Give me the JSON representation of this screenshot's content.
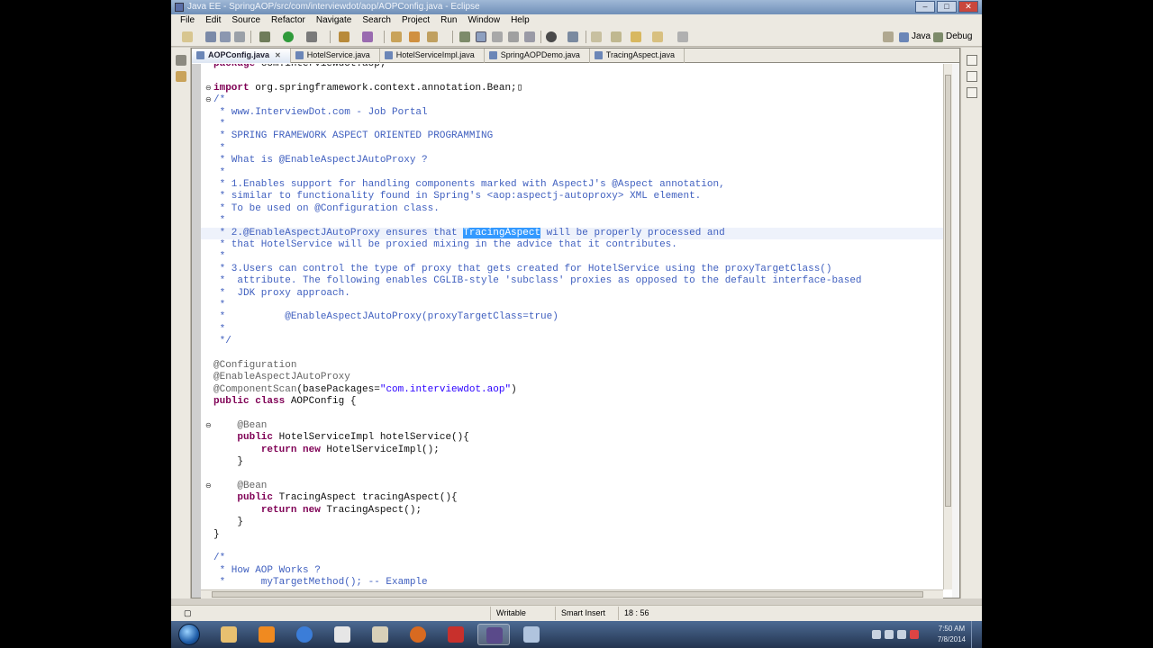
{
  "window": {
    "title": "Java EE - SpringAOP/src/com/interviewdot/aop/AOPConfig.java - Eclipse",
    "controls": [
      "–",
      "□",
      "✕"
    ]
  },
  "menu": [
    "File",
    "Edit",
    "Source",
    "Refactor",
    "Navigate",
    "Search",
    "Project",
    "Run",
    "Window",
    "Help"
  ],
  "perspectives": {
    "java": "Java",
    "debug": "Debug"
  },
  "tabs": [
    {
      "label": "AOPConfig.java",
      "active": true
    },
    {
      "label": "HotelService.java",
      "active": false
    },
    {
      "label": "HotelServiceImpl.java",
      "active": false
    },
    {
      "label": "SpringAOPDemo.java",
      "active": false
    },
    {
      "label": "TracingAspect.java",
      "active": false
    }
  ],
  "code": [
    [
      [
        "package",
        "kw"
      ],
      [
        " com.interviewdot.aop;",
        ""
      ]
    ],
    [],
    [
      [
        "import",
        "kw"
      ],
      [
        " org.springframework.context.annotation.Bean;",
        ""
      ],
      [
        "▯",
        ""
      ]
    ],
    [
      [
        "/*",
        "cm"
      ]
    ],
    [
      [
        " * www.InterviewDot.com - Job Portal",
        "cm"
      ]
    ],
    [
      [
        " *",
        "cm"
      ]
    ],
    [
      [
        " * SPRING FRAMEWORK ASPECT ORIENTED PROGRAMMING",
        "cm"
      ]
    ],
    [
      [
        " *",
        "cm"
      ]
    ],
    [
      [
        " * What is @EnableAspectJAutoProxy ?",
        "cm"
      ]
    ],
    [
      [
        " *",
        "cm"
      ]
    ],
    [
      [
        " * 1.Enables support for handling components marked with AspectJ's @Aspect annotation,",
        "cm"
      ]
    ],
    [
      [
        " * similar to functionality found in Spring's <aop:aspectj-autoproxy> XML element.",
        "cm"
      ]
    ],
    [
      [
        " * To be used on @Configuration class.",
        "cm"
      ]
    ],
    [
      [
        " *",
        "cm"
      ]
    ],
    [
      [
        " * 2.@EnableAspectJAutoProxy ensures that ",
        "cm"
      ],
      [
        "TracingAspect",
        "sel"
      ],
      [
        " will be properly processed and",
        "cm"
      ]
    ],
    [
      [
        " * that HotelService will be proxied mixing in the advice that it contributes.",
        "cm"
      ]
    ],
    [
      [
        " *",
        "cm"
      ]
    ],
    [
      [
        " * 3.Users can control the type of proxy that gets created for HotelService using the proxyTargetClass()",
        "cm"
      ]
    ],
    [
      [
        " *  attribute. The following enables CGLIB-style 'subclass' proxies as opposed to the default interface-based",
        "cm"
      ]
    ],
    [
      [
        " *  JDK proxy approach.",
        "cm"
      ]
    ],
    [
      [
        " *",
        "cm"
      ]
    ],
    [
      [
        " *          @EnableAspectJAutoProxy(proxyTargetClass=true)",
        "cm"
      ]
    ],
    [
      [
        " *",
        "cm"
      ]
    ],
    [
      [
        " */",
        "cm"
      ]
    ],
    [],
    [
      [
        "@Configuration",
        "an"
      ]
    ],
    [
      [
        "@EnableAspectJAutoProxy",
        "an"
      ]
    ],
    [
      [
        "@ComponentScan",
        "an"
      ],
      [
        "(basePackages=",
        ""
      ],
      [
        "\"com.interviewdot.aop\"",
        "st"
      ],
      [
        ")",
        ""
      ]
    ],
    [
      [
        "public class",
        "kw"
      ],
      [
        " AOPConfig {",
        ""
      ]
    ],
    [],
    [
      [
        "    @Bean",
        "an"
      ]
    ],
    [
      [
        "    ",
        ""
      ],
      [
        "public",
        "kw"
      ],
      [
        " HotelServiceImpl hotelService(){",
        ""
      ]
    ],
    [
      [
        "        ",
        ""
      ],
      [
        "return new",
        "kw"
      ],
      [
        " HotelServiceImpl();",
        ""
      ]
    ],
    [
      [
        "    }",
        ""
      ]
    ],
    [],
    [
      [
        "    @Bean",
        "an"
      ]
    ],
    [
      [
        "    ",
        ""
      ],
      [
        "public",
        "kw"
      ],
      [
        " TracingAspect tracingAspect(){",
        ""
      ]
    ],
    [
      [
        "        ",
        ""
      ],
      [
        "return new",
        "kw"
      ],
      [
        " TracingAspect();",
        ""
      ]
    ],
    [
      [
        "    }",
        ""
      ]
    ],
    [
      [
        "}",
        ""
      ]
    ],
    [],
    [
      [
        "/*",
        "cm"
      ]
    ],
    [
      [
        " * How AOP Works ?",
        "cm"
      ]
    ],
    [
      [
        " *      myTargetMethod(); -- Example",
        "cm"
      ]
    ]
  ],
  "status": {
    "writable": "Writable",
    "insert_mode": "Smart Insert",
    "position": "18 : 56"
  },
  "clock": {
    "time": "7:50 AM",
    "date": "7/8/2014"
  },
  "taskbar": [
    "explorer",
    "vlc",
    "browser",
    "media-player",
    "file-manager",
    "firefox",
    "archive-tool",
    "eclipse",
    "notes"
  ]
}
